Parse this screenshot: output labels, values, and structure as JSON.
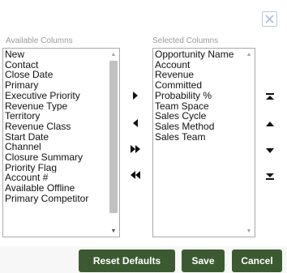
{
  "dialog": {
    "close_icon": "close-x-icon"
  },
  "available": {
    "label": "Available Columns",
    "items": [
      "New",
      "Contact",
      "Close Date",
      "Primary",
      "Executive Priority",
      "Revenue Type",
      "Territory",
      "Revenue Class",
      "Start Date",
      "Channel",
      "Closure Summary",
      "Priority Flag",
      "Account #",
      "Available Offline",
      "Primary Competitor"
    ]
  },
  "selected": {
    "label": "Selected Columns",
    "items": [
      "Opportunity Name",
      "Account",
      "Revenue",
      "Committed",
      "Probability %",
      "Team Space",
      "Sales Cycle",
      "Sales Method",
      "Sales Team"
    ]
  },
  "move_controls": {
    "icons": [
      "move-right-icon",
      "move-left-icon",
      "move-all-right-icon",
      "move-all-left-icon"
    ]
  },
  "order_controls": {
    "icons": [
      "move-to-top-icon",
      "move-up-icon",
      "move-down-icon",
      "move-to-bottom-icon"
    ]
  },
  "buttons": {
    "reset": "Reset Defaults",
    "save": "Save",
    "cancel": "Cancel"
  },
  "colors": {
    "button_bg": "#3c5a31",
    "close_border": "#b7c9de",
    "close_x": "#a7bcd6"
  }
}
